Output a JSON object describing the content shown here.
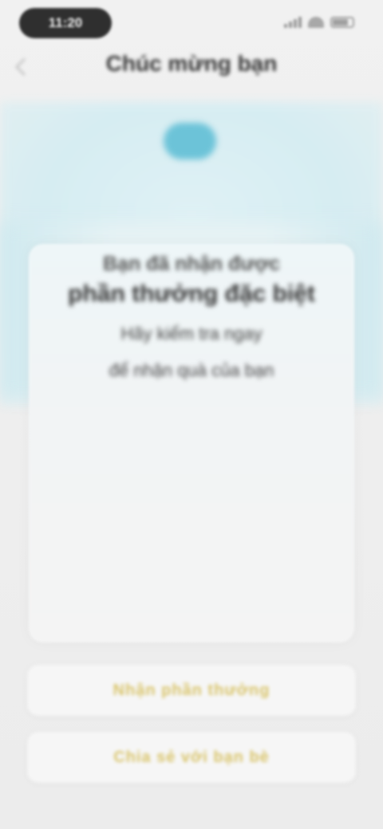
{
  "status_bar": {
    "time": "11:20",
    "icons": [
      "signal-icon",
      "wifi-icon",
      "battery-icon"
    ],
    "battery_level": 0.8
  },
  "header": {
    "title": "Chúc mừng bạn",
    "subtitle": ""
  },
  "card": {
    "heading": "Bạn đã nhận được",
    "headline": "phần thưởng đặc biệt",
    "line1": "Hãy kiểm tra ngay",
    "line2": "để nhận quà của bạn"
  },
  "actions": {
    "primary_label": "Nhận phần thưởng",
    "secondary_label": "Chia sẻ với bạn bè"
  },
  "colors": {
    "accent": "#6cc3d8",
    "button_text": "#d9c46a",
    "hero_background": "#d6edf2"
  }
}
